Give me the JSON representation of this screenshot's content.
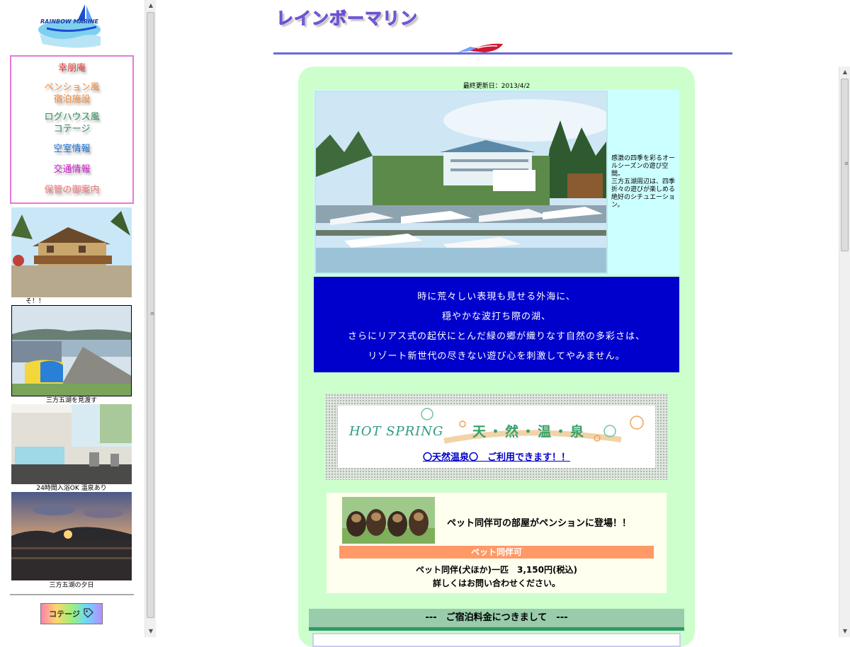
{
  "left": {
    "logo_text": "RAINBOW MARINE",
    "nav": [
      {
        "label": "幸朋庵",
        "color": "#e03a3a"
      },
      {
        "label": "ペンション風\n宿泊施設",
        "color": "#f08a3c"
      },
      {
        "label": "ログハウス風\nコテージ",
        "color": "#2e8b57"
      },
      {
        "label": "空室情報",
        "color": "#1e6fd0"
      },
      {
        "label": "交通情報",
        "color": "#d020c8"
      },
      {
        "label": "保管の御案内",
        "color": "#ee7a7a"
      }
    ],
    "captions": [
      "そ！！",
      "三方五湖を見渡す",
      "24時間入浴OK 温泉あり",
      "三方五湖の夕日"
    ],
    "cottage_button": "コテージ"
  },
  "right": {
    "site_title": "レインボーマリン",
    "update_date": "最終更新日：2013/4/2",
    "hero_text": [
      "感激の四季を彩るオールシーズンの遊び空間。",
      "三方五湖周辺は、四季折々の遊びが楽しめる絶好のシチュエーション。"
    ],
    "blue_lines": [
      "時に荒々しい表現も見せる外海に、",
      "穏やかな波打ち際の湖、",
      "さらにリアス式の起伏にとんだ緑の郷が織りなす自然の多彩さは、",
      "リゾート新世代の尽きない遊び心を刺激してやみません。"
    ],
    "hot_spring": {
      "english": "HOT SPRING",
      "japanese": "天・然・温・泉",
      "link": "〇天然温泉〇　ご利用できます！！"
    },
    "pet": {
      "headline": "ペット同伴可の部屋がペンションに登場！！",
      "bar": "ペット同伴可",
      "price": "ペット同伴(犬ほか)一匹　3,150円(税込)",
      "contact": "詳しくはお問い合わせください。"
    },
    "rates_header": "---　ご宿泊料金につきまして　---"
  },
  "colors": {
    "panel_green": "#ccffcc",
    "blue_box": "#0000cc",
    "pet_bar": "#ff9966",
    "nav_border": "#e57ad8"
  }
}
